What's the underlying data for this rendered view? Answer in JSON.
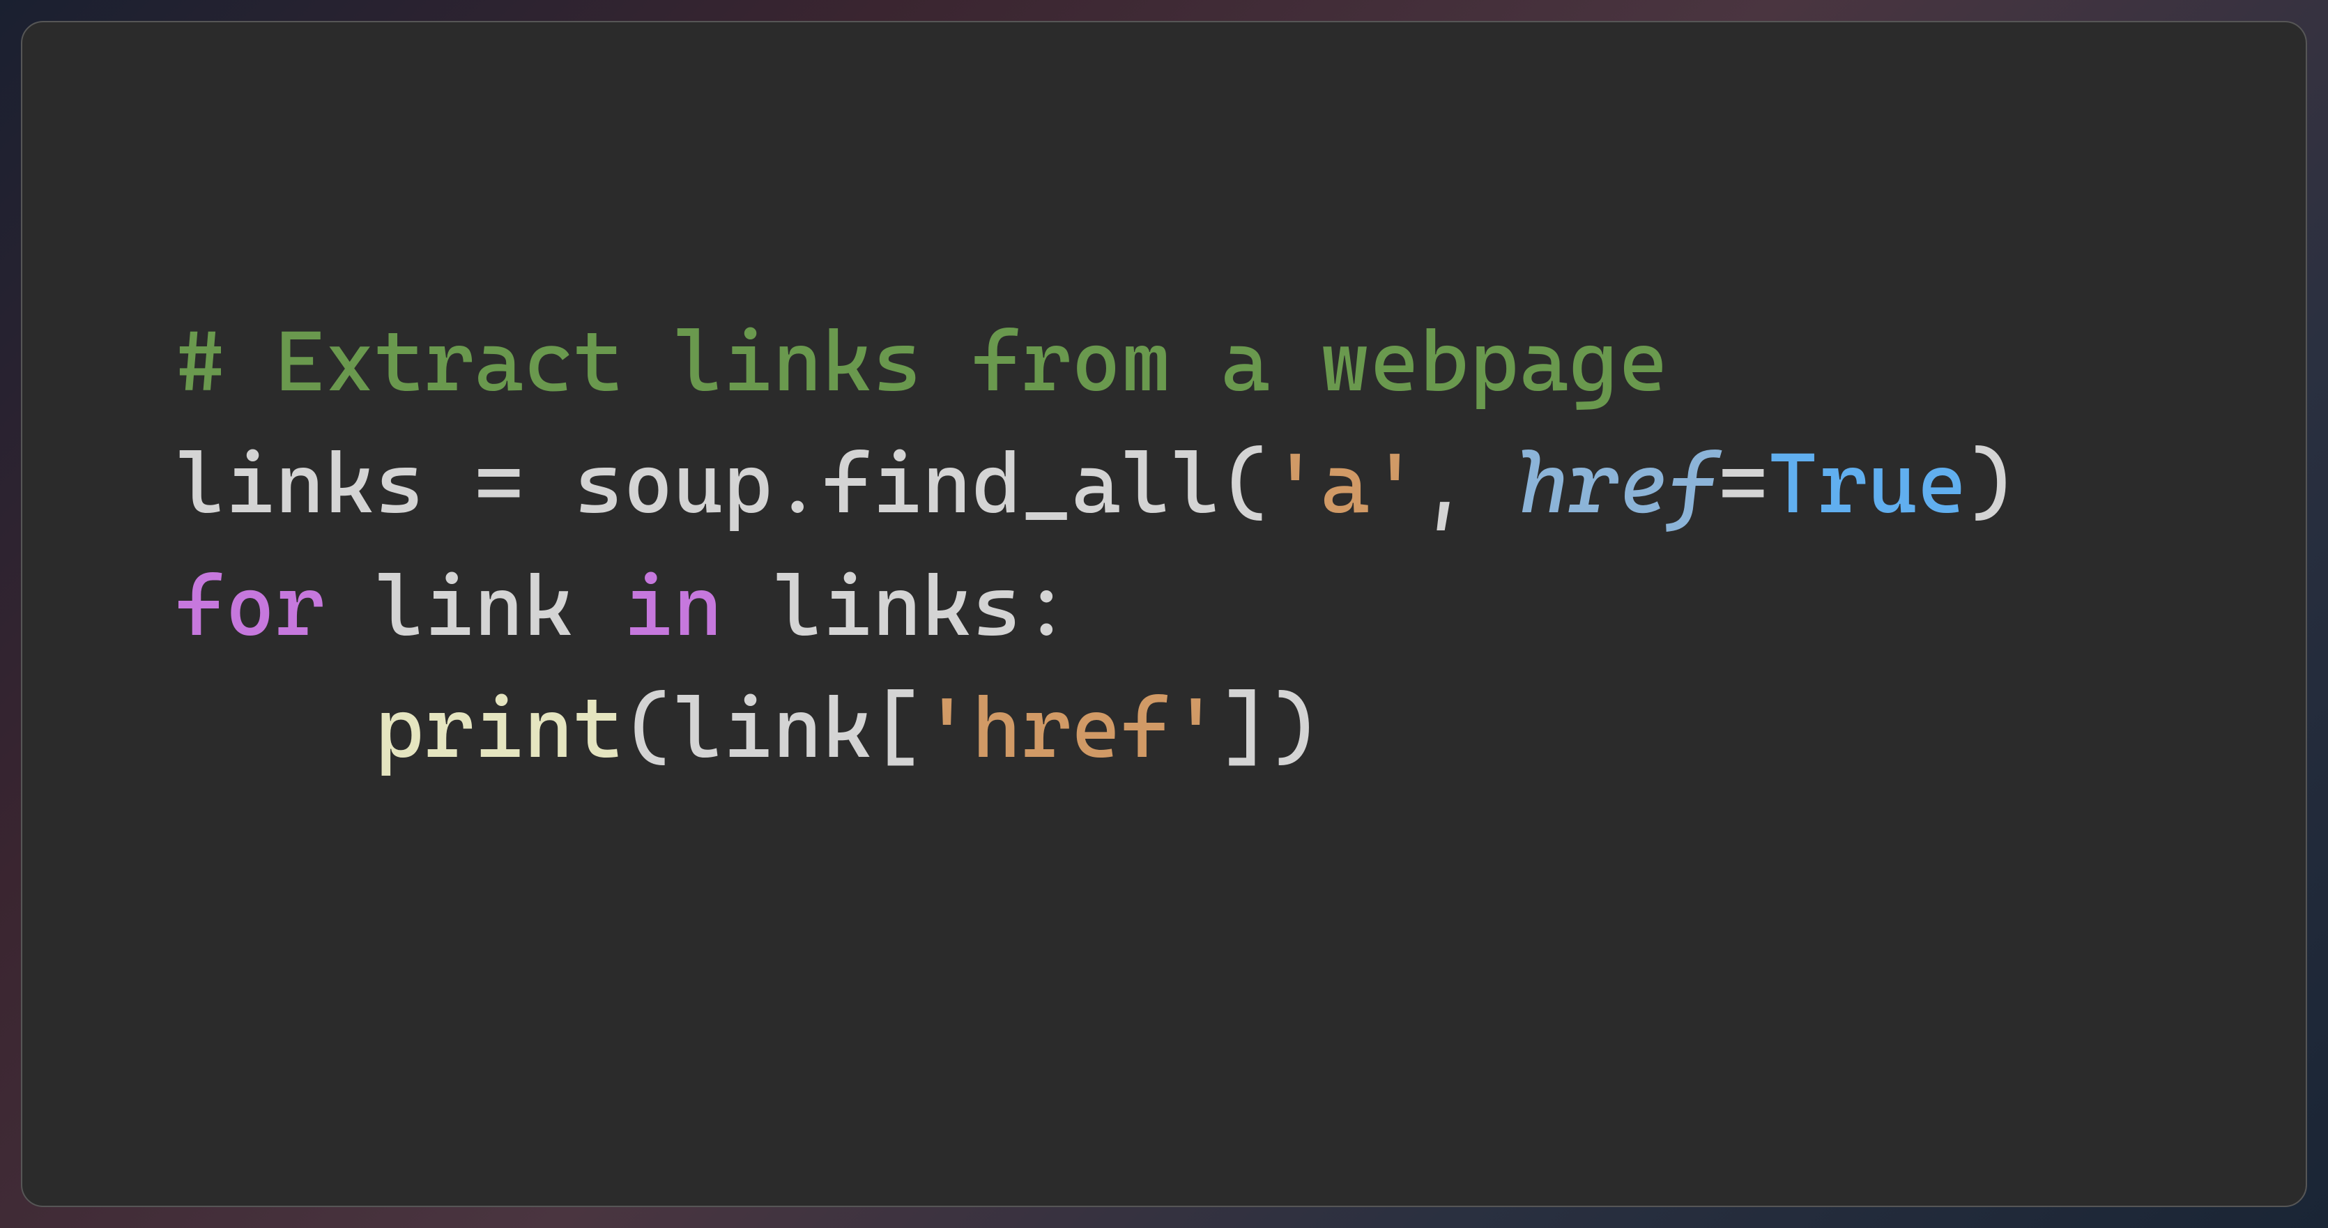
{
  "code": {
    "comment": "# Extract links from a webpage",
    "line2": {
      "var": "links",
      "eq": " = ",
      "obj": "soup.",
      "method": "find_all",
      "lparen": "(",
      "arg_str": "'a'",
      "comma": ", ",
      "kw": "href",
      "eq2": "=",
      "val": "True",
      "rparen": ")"
    },
    "line3": {
      "for": "for",
      "sp1": " ",
      "item": "link",
      "sp2": " ",
      "in": "in",
      "sp3": " ",
      "iter": "links",
      "colon": ":"
    },
    "line4": {
      "indent": "    ",
      "fn": "print",
      "lparen": "(",
      "obj": "link",
      "lbrack": "[",
      "key": "'href'",
      "rbrack": "]",
      "rparen": ")"
    }
  }
}
